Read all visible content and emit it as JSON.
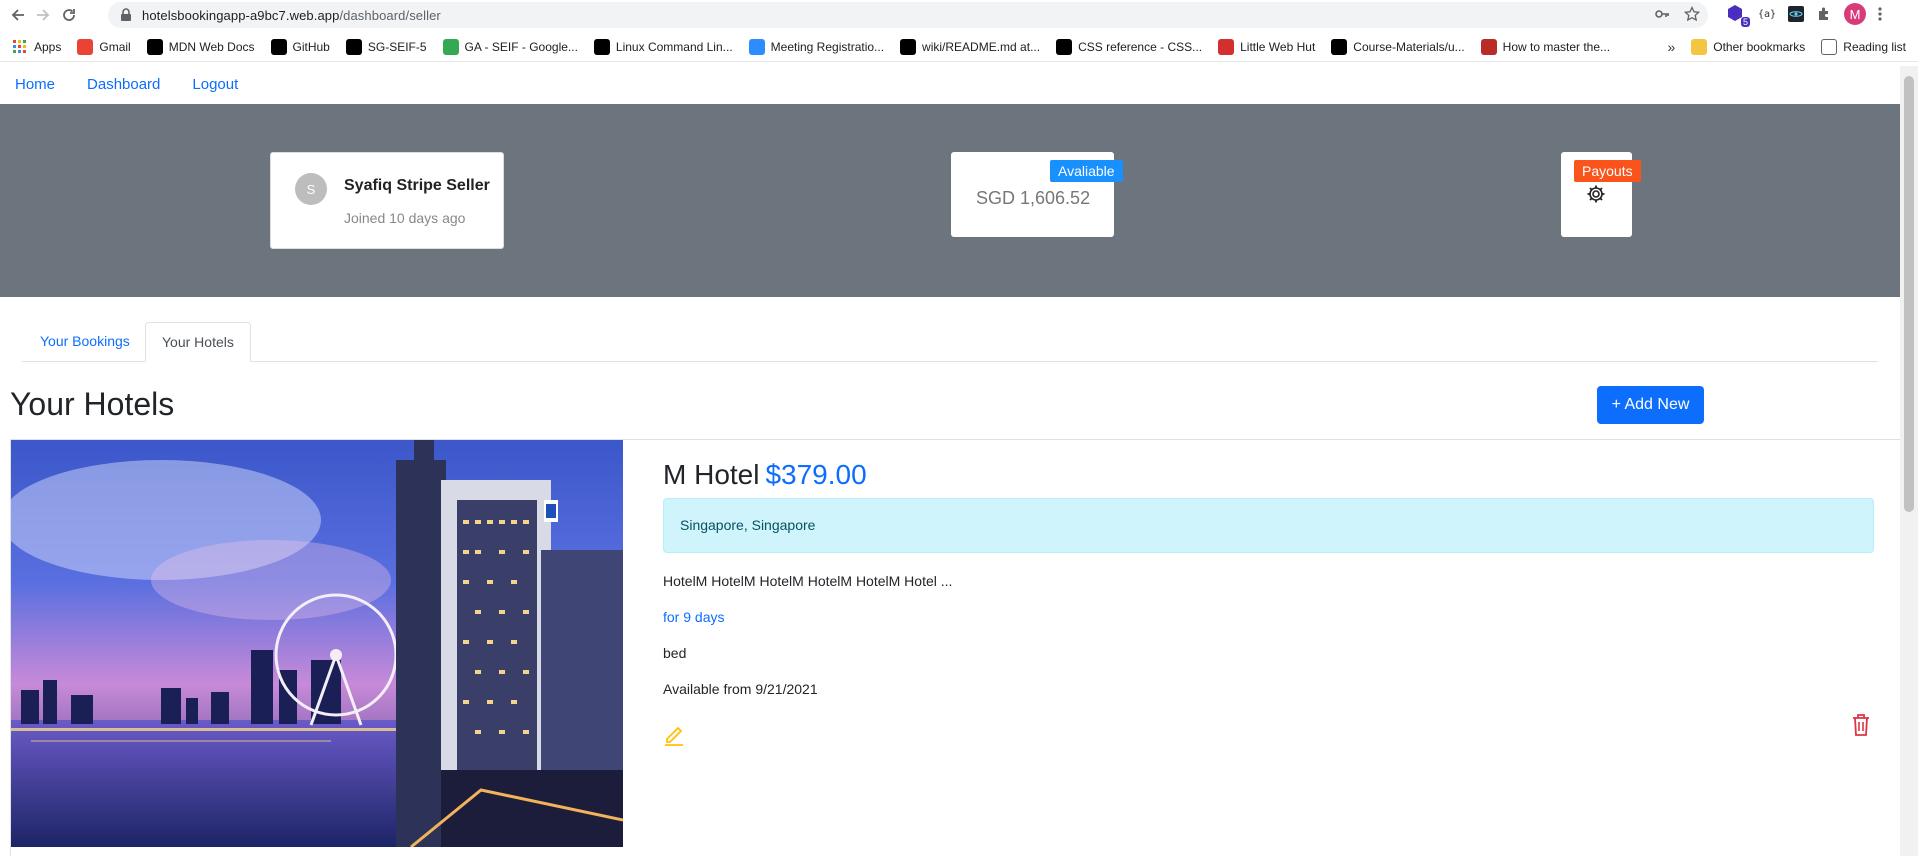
{
  "browser": {
    "url_host": "hotelsbookingapp-a9bc7.web.app",
    "url_path": "/dashboard/seller",
    "extension_badge": "5",
    "profile_initial": "M",
    "bookmarks": [
      {
        "label": "Apps",
        "icon": "apps-grid-icon",
        "color": "#ea4335"
      },
      {
        "label": "Gmail",
        "icon": "gmail-icon",
        "color": "#ea4335"
      },
      {
        "label": "MDN Web Docs",
        "icon": "mdn-icon",
        "color": "#000000"
      },
      {
        "label": "GitHub",
        "icon": "github-icon",
        "color": "#000000"
      },
      {
        "label": "SG-SEIF-5",
        "icon": "github-icon",
        "color": "#000000"
      },
      {
        "label": "GA - SEIF - Google...",
        "icon": "google-drive-icon",
        "color": "#34a853"
      },
      {
        "label": "Linux Command Lin...",
        "icon": "linux-icon",
        "color": "#000000"
      },
      {
        "label": "Meeting Registratio...",
        "icon": "zoom-icon",
        "color": "#2d8cff"
      },
      {
        "label": "wiki/README.md at...",
        "icon": "github-icon",
        "color": "#000000"
      },
      {
        "label": "CSS reference - CSS...",
        "icon": "mdn-icon",
        "color": "#000000"
      },
      {
        "label": "Little Web Hut",
        "icon": "plane-icon",
        "color": "#d32f2f"
      },
      {
        "label": "Course-Materials/u...",
        "icon": "github-icon",
        "color": "#000000"
      },
      {
        "label": "How to master the...",
        "icon": "quora-icon",
        "color": "#b92b27"
      }
    ],
    "more_bookmarks": "»",
    "other_bookmarks": "Other bookmarks",
    "reading_list": "Reading list"
  },
  "nav": {
    "home": "Home",
    "dashboard": "Dashboard",
    "logout": "Logout"
  },
  "seller": {
    "avatar_initial": "S",
    "name": "Syafiq Stripe Seller",
    "joined": "Joined 10 days ago"
  },
  "balance": {
    "ribbon": "Avaliable",
    "amount": "SGD 1,606.52"
  },
  "payouts": {
    "ribbon": "Payouts"
  },
  "tabs": {
    "bookings": "Your Bookings",
    "hotels": "Your Hotels"
  },
  "page": {
    "title": "Your Hotels",
    "add_button": "+ Add New"
  },
  "hotel": {
    "name": "M Hotel",
    "price": "$379.00",
    "location": "Singapore, Singapore",
    "description": "HotelM HotelM HotelM HotelM HotelM Hotel ...",
    "duration": "for 9 days",
    "bed": "bed",
    "available": "Available from 9/21/2021"
  },
  "colors": {
    "primary": "#0d6efd",
    "banner": "#6c757d",
    "available_ribbon": "#1890ff",
    "payout_ribbon": "#fa541c",
    "edit": "#ffc107",
    "delete": "#dc3545"
  }
}
